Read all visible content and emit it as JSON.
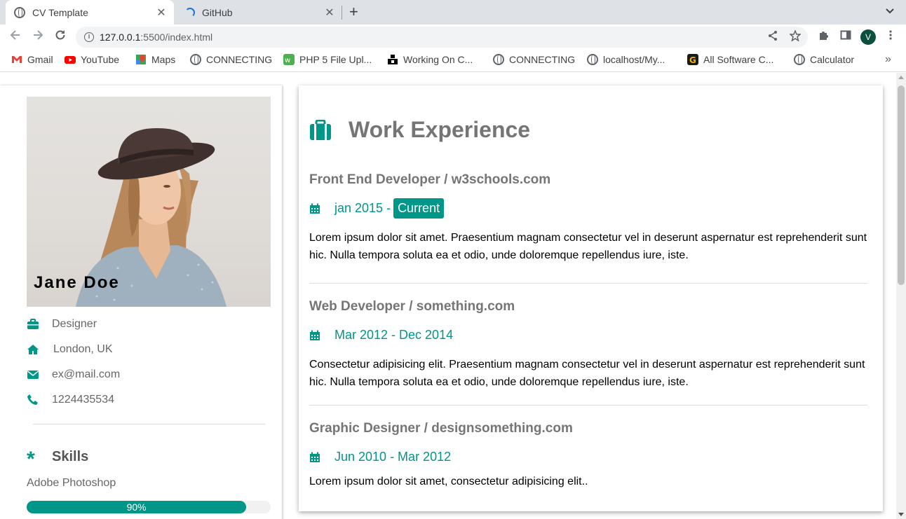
{
  "browser": {
    "tabs": [
      {
        "title": "CV Template",
        "active": true
      },
      {
        "title": "GitHub",
        "active": false
      }
    ],
    "url_host": "127.0.0.1",
    "url_path": ":5500/index.html",
    "avatar_letter": "V",
    "bookmarks": [
      {
        "label": "Gmail",
        "icon": "gmail-icon"
      },
      {
        "label": "YouTube",
        "icon": "youtube-icon"
      },
      {
        "label": "Maps",
        "icon": "maps-icon"
      },
      {
        "label": "CONNECTING",
        "icon": "globe-icon"
      },
      {
        "label": "PHP 5 File Upl...",
        "icon": "w3schools-icon"
      },
      {
        "label": "Working On C...",
        "icon": "site-icon"
      },
      {
        "label": "CONNECTING",
        "icon": "globe-icon"
      },
      {
        "label": "localhost/My...",
        "icon": "globe-icon"
      },
      {
        "label": "All Software C...",
        "icon": "g-icon"
      },
      {
        "label": "Calculator",
        "icon": "globe-icon"
      }
    ]
  },
  "profile": {
    "name": "Jane Doe",
    "role": "Designer",
    "location": "London, UK",
    "email": "ex@mail.com",
    "phone": "1224435534"
  },
  "skills": {
    "title": "Skills",
    "items": [
      {
        "name": "Adobe Photoshop",
        "percent": 90,
        "percent_label": "90%"
      }
    ]
  },
  "work": {
    "title": "Work Experience",
    "jobs": [
      {
        "title": "Front End Developer / w3schools.com",
        "date": "jan 2015 -",
        "current": "Current",
        "description": "Lorem ipsum dolor sit amet. Praesentium magnam consectetur vel in deserunt aspernatur est reprehenderit sunt hic. Nulla tempora soluta ea et odio, unde doloremque repellendus iure, iste."
      },
      {
        "title": "Web Developer / something.com",
        "date": "Mar 2012 - Dec 2014",
        "description": "Consectetur adipisicing elit. Praesentium magnam consectetur vel in deserunt aspernatur est reprehenderit sunt hic. Nulla tempora soluta ea et odio, unde doloremque repellendus iure, iste."
      },
      {
        "title": "Graphic Designer / designsomething.com",
        "date": "Jun 2010 - Mar 2012",
        "description": "Lorem ipsum dolor sit amet, consectetur adipisicing elit.."
      }
    ]
  },
  "colors": {
    "accent": "#009688",
    "heading": "#757575",
    "muted_text": "#666666"
  }
}
